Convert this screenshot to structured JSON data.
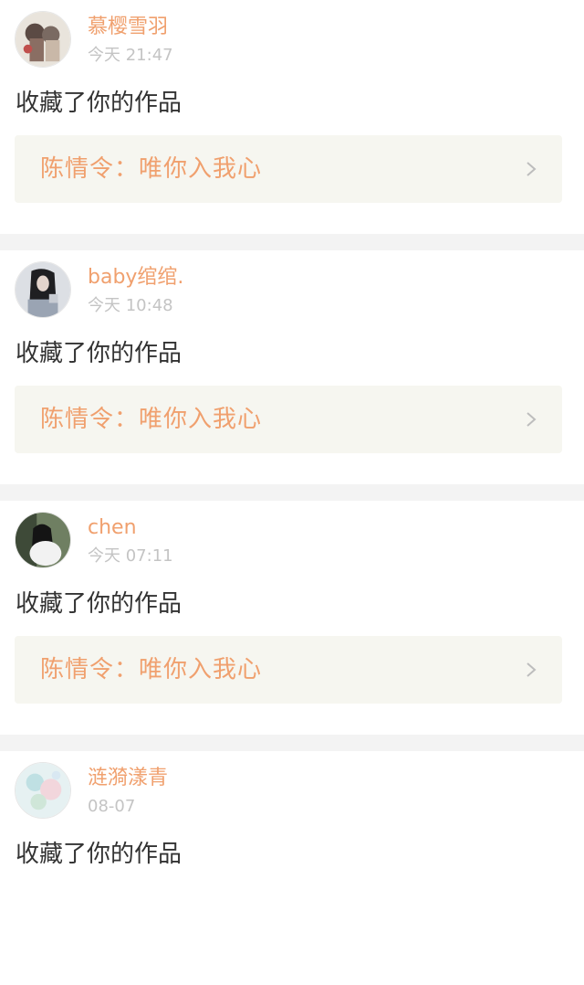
{
  "feed": [
    {
      "username": "慕樱雪羽",
      "time": "今天 21:47",
      "action": "收藏了你的作品",
      "work_title": "陈情令：唯你入我心"
    },
    {
      "username": "baby绾绾.",
      "time": "今天 10:48",
      "action": "收藏了你的作品",
      "work_title": "陈情令：唯你入我心"
    },
    {
      "username": "chen",
      "time": "今天 07:11",
      "action": "收藏了你的作品",
      "work_title": "陈情令：唯你入我心"
    },
    {
      "username": "涟漪漾青",
      "time": "08-07",
      "action": "收藏了你的作品"
    }
  ],
  "colors": {
    "accent": "#f0a06e",
    "time": "#c4c4c4",
    "text": "#333333",
    "link_bg": "#f6f6f0",
    "separator": "#f3f3f3"
  },
  "icons": {
    "chevron": "chevron-right-icon"
  }
}
